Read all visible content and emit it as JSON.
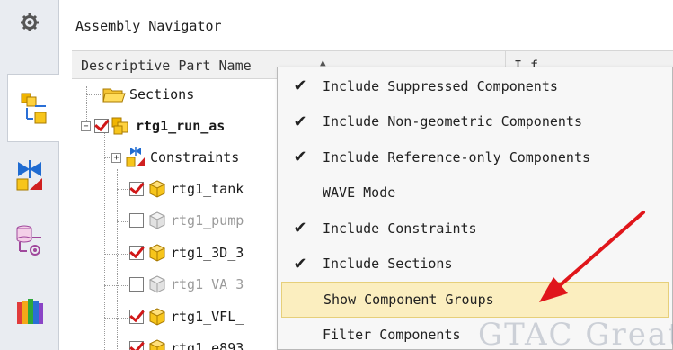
{
  "navigator": {
    "title": "Assembly Navigator",
    "column_name": "Descriptive Part Name",
    "column_second": "I f"
  },
  "tree": [
    {
      "label": "Sections",
      "icon": "folder-icon",
      "checked": null,
      "bold": false,
      "dim": false
    },
    {
      "label": "rtg1_run_as",
      "icon": "assembly-icon",
      "checked": true,
      "bold": true,
      "dim": false
    },
    {
      "label": "Constraints",
      "icon": "constraints-icon",
      "checked": null,
      "bold": false,
      "dim": false
    },
    {
      "label": "rtg1_tank",
      "icon": "part-icon",
      "checked": true,
      "bold": false,
      "dim": false
    },
    {
      "label": "rtg1_pump",
      "icon": "part-icon",
      "checked": false,
      "bold": false,
      "dim": true
    },
    {
      "label": "rtg1_3D_3",
      "icon": "part-icon",
      "checked": true,
      "bold": false,
      "dim": false
    },
    {
      "label": "rtg1_VA_3",
      "icon": "part-icon",
      "checked": false,
      "bold": false,
      "dim": true
    },
    {
      "label": "rtg1_VFL_",
      "icon": "part-icon",
      "checked": true,
      "bold": false,
      "dim": false
    },
    {
      "label": "rtg1_e893",
      "icon": "part-icon",
      "checked": true,
      "bold": false,
      "dim": false
    }
  ],
  "menu": [
    {
      "label": "Include Suppressed Components",
      "checked": true,
      "highlighted": false
    },
    {
      "label": "Include Non-geometric Components",
      "checked": true,
      "highlighted": false
    },
    {
      "label": "Include Reference-only Components",
      "checked": true,
      "highlighted": false
    },
    {
      "label": "WAVE Mode",
      "checked": false,
      "highlighted": false
    },
    {
      "label": "Include Constraints",
      "checked": true,
      "highlighted": false
    },
    {
      "label": "Include Sections",
      "checked": true,
      "highlighted": false
    },
    {
      "label": "Show Component Groups",
      "checked": false,
      "highlighted": true
    },
    {
      "label": "Filter Components",
      "checked": false,
      "highlighted": false
    }
  ],
  "tick_glyph": "✔",
  "watermark": "GTAC Great",
  "colors": {
    "check": "#d11818",
    "highlight": "#fbeebf",
    "arrow": "#e0161b"
  }
}
